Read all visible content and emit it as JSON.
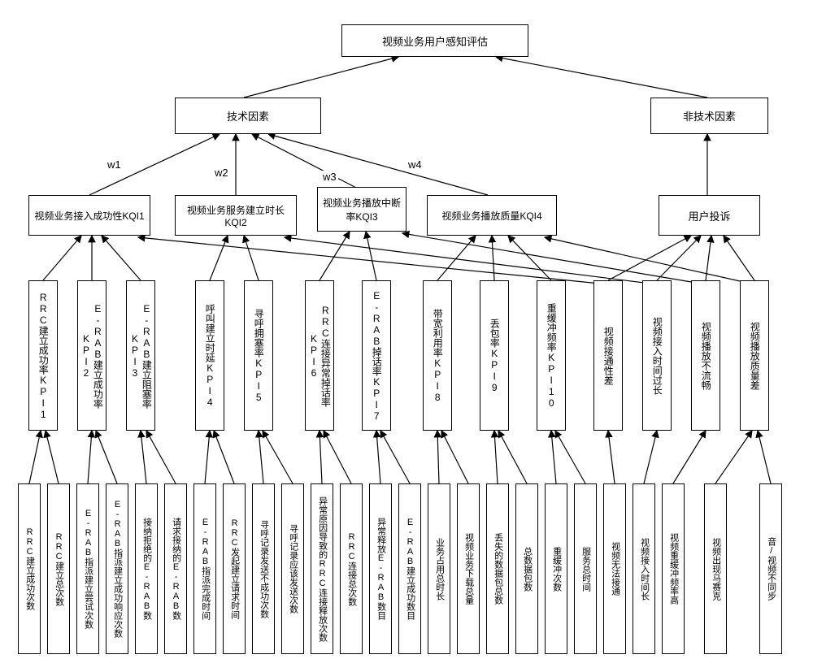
{
  "root": "视频业务用户感知评估",
  "level2": {
    "tech": "技术因素",
    "nontech": "非技术因素"
  },
  "weights": {
    "w1": "w1",
    "w2": "w2",
    "w3": "w3",
    "w4": "w4"
  },
  "kqi": {
    "kqi1": "视频业务接入成功性KQI1",
    "kqi2": "视频业务服务建立时长KQI2",
    "kqi3": "视频业务播放中断率KQI3",
    "kqi4": "视频业务播放质量KQI4"
  },
  "complaint": "用户投诉",
  "kpi": {
    "kpi1": "RRC建立成功率KPI1",
    "kpi2": "E-RAB建立成功率KPI2",
    "kpi3": "E-RAB建立阻塞率KPI3",
    "kpi4": "呼叫建立时延KPI4",
    "kpi5": "寻呼拥塞率KPI5",
    "kpi6": "RRC连接异常掉话率KPI6",
    "kpi7": "E-RAB掉话率KPI7",
    "kpi8": "带宽利用率KPI8",
    "kpi9": "丢包率KPI9",
    "kpi10": "重缓冲频率KPI10"
  },
  "complaint_items": {
    "c1": "视频接通性差",
    "c2": "视频接入时间过长",
    "c3": "视频播放不流畅",
    "c4": "视频播放质量差"
  },
  "metrics": {
    "m1": "RRC建立成功次数",
    "m2": "RRC建立总次数",
    "m3": "E-RAB指派建立尝试次数",
    "m4": "E-RAB指派建立成功响应次数",
    "m5": "接纳拒绝的E-RAB数",
    "m6": "请求接纳的E-RAB数",
    "m7": "E-RAB指派完成时间",
    "m8": "RRC发起建立请求时间",
    "m9": "寻呼记录发送不成功次数",
    "m10": "寻呼记录应该发送次数",
    "m11": "异常原因导致的RRC连接释放次数",
    "m12": "RRC连接总次数",
    "m13": "异常释放E-RAB数目",
    "m14": "E-RAB建立成功数目",
    "m15": "业务占用总时长",
    "m16": "视频业务下载总量",
    "m17": "丢失的数据包总数",
    "m18": "总数据包数",
    "m19": "重缓冲次数",
    "m20": "服务总时间",
    "m21": "视频无法接通",
    "m22": "视频接入时间长",
    "m23": "视频重缓冲频率高",
    "m24": "视频出现马赛克",
    "m25": "音/视频不同步"
  }
}
